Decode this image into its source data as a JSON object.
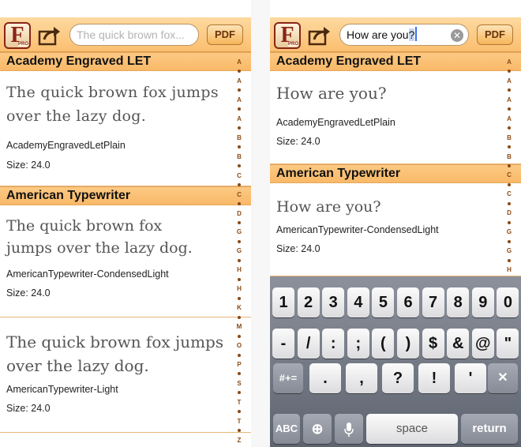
{
  "left": {
    "search_placeholder": "The quick brown fox...",
    "pdf_label": "PDF",
    "rows": [
      {
        "header": "Academy Engraved LET",
        "sample": "The quick brown fox jumps over the lazy dog.",
        "name": "AcademyEngravedLetPlain",
        "size": "Size: 24.0"
      },
      {
        "header": "American Typewriter",
        "sample": "The quick brown fox jumps over the lazy dog.",
        "name": "AmericanTypewriter-CondensedLight",
        "size": "Size: 24.0"
      },
      {
        "header": "",
        "sample": "The quick brown fox jumps over the lazy dog.",
        "name": "AmericanTypewriter-Light",
        "size": "Size: 24.0"
      }
    ],
    "index_letters": [
      "A",
      "A",
      "A",
      "A",
      "B",
      "B",
      "C",
      "C",
      "D",
      "G",
      "G",
      "H",
      "H",
      "K",
      "M",
      "O",
      "P",
      "S",
      "T",
      "T",
      "Z"
    ]
  },
  "right": {
    "search_value": "How are you",
    "search_selected": "?",
    "pdf_label": "PDF",
    "rows": [
      {
        "header": "Academy Engraved LET",
        "sample": "How are you?",
        "name": "AcademyEngravedLetPlain",
        "size": "Size: 24.0"
      },
      {
        "header": "American Typewriter",
        "sample": "How are you?",
        "name": "AmericanTypewriter-CondensedLight",
        "size": "Size: 24.0"
      }
    ],
    "index_letters": [
      "A",
      "A",
      "A",
      "A",
      "B",
      "B",
      "C",
      "C",
      "D",
      "G",
      "G",
      "H"
    ]
  },
  "keyboard": {
    "row1": [
      "1",
      "2",
      "3",
      "4",
      "5",
      "6",
      "7",
      "8",
      "9",
      "0"
    ],
    "row2": [
      "-",
      "/",
      ":",
      ";",
      "(",
      ")",
      "$",
      "&",
      "@",
      "\""
    ],
    "mode_key": "#+=",
    "row3": [
      ".",
      ",",
      "?",
      "!",
      "'"
    ],
    "abc_key": "ABC",
    "space_key": "space",
    "return_key": "return"
  },
  "icons": {
    "app_icon_letter": "F",
    "app_icon_badge": "PRO",
    "delete_glyph": "✕",
    "clear_glyph": "✕",
    "globe_glyph": "⊕"
  },
  "colors": {
    "toolbar": "#fbbf70",
    "header": "#f9b968",
    "accent_text": "#8a4a14"
  }
}
